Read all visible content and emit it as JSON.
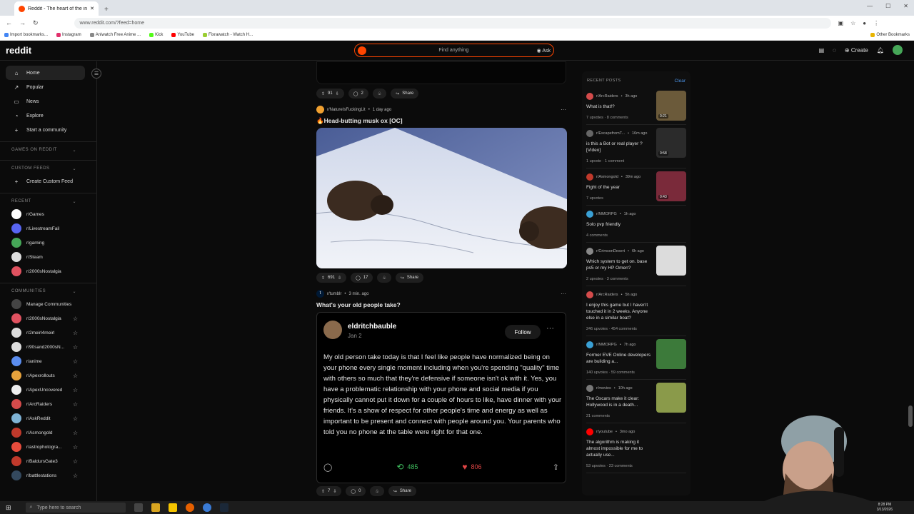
{
  "browser": {
    "tab_title": "Reddit - The heart of the intern",
    "url": "www.reddit.com/?feed=home",
    "bookmarks": [
      "Import bookmarks...",
      "Instagram",
      "Aniwatch Free Anime ...",
      "Kick",
      "YouTube",
      "Fixrawatch - Watch H..."
    ],
    "other_bookmarks": "Other Bookmarks"
  },
  "header": {
    "logo": "reddit",
    "search_placeholder": "Find anything",
    "ask_label": "Ask",
    "create_label": "Create"
  },
  "sidebar": {
    "nav": [
      {
        "label": "Home",
        "icon": "home-icon",
        "active": true
      },
      {
        "label": "Popular",
        "icon": "popular-icon"
      },
      {
        "label": "News",
        "icon": "news-icon"
      },
      {
        "label": "Explore",
        "icon": "explore-icon"
      },
      {
        "label": "Start a community",
        "icon": "plus-icon"
      }
    ],
    "games_heading": "GAMES ON REDDIT",
    "custom_feeds_heading": "CUSTOM FEEDS",
    "create_custom_feed": "Create Custom Feed",
    "recent_heading": "RECENT",
    "recent": [
      {
        "name": "r/Games",
        "color": "#ffffff"
      },
      {
        "name": "r/LivestreamFail",
        "color": "#5865f2"
      },
      {
        "name": "r/gaming",
        "color": "#46a758"
      },
      {
        "name": "r/Steam",
        "color": "#dddddd"
      },
      {
        "name": "r/2000sNostalgia",
        "color": "#e05260"
      }
    ],
    "communities_heading": "COMMUNITIES",
    "manage_communities": "Manage Communities",
    "communities": [
      {
        "name": "r/2000sNostalgia",
        "color": "#e05260"
      },
      {
        "name": "r/2meirl4meirl",
        "color": "#dddddd"
      },
      {
        "name": "r/90sand2000sN...",
        "color": "#dddddd"
      },
      {
        "name": "r/anime",
        "color": "#5b8def"
      },
      {
        "name": "r/Apexrollouts",
        "color": "#e8a33d"
      },
      {
        "name": "r/ApexUncovered",
        "color": "#eeeeee"
      },
      {
        "name": "r/ArcRaiders",
        "color": "#d44b4b"
      },
      {
        "name": "r/AskReddit",
        "color": "#7fb3d5"
      },
      {
        "name": "r/Asmongold",
        "color": "#c0392b"
      },
      {
        "name": "r/astrophotogra...",
        "color": "#e74c3c"
      },
      {
        "name": "r/BaldursGate3",
        "color": "#c0392b"
      },
      {
        "name": "r/battlestations",
        "color": "#34495e"
      }
    ]
  },
  "feed": {
    "post0_actions": {
      "votes": "91",
      "comments": "2",
      "share": "Share"
    },
    "post1": {
      "subreddit": "r/NatureIsFuckingLit",
      "time": "1 day ago",
      "title": "🔥Head-butting musk ox [OC]",
      "votes": "691",
      "comments": "17",
      "share": "Share"
    },
    "post2": {
      "subreddit": "r/tumblr",
      "time": "3 min. ago",
      "title": "What's your old people take?",
      "tweet_user": "eldritchbauble",
      "tweet_date": "Jan 2",
      "follow_label": "Follow",
      "tweet_text": "My old person take today is that I feel like people have normalized being on your phone every single moment including when you're spending \"quality\" time with others so much that they're defensive if someone isn't ok with it. Yes, you have a problematic relationship with your phone and social media if you physically cannot put it down for a couple of hours to like, have dinner with your friends. It's a show of respect for other people's time and energy as well as important to be present and connect with people around you. Your parents who told you no phone at the table were right for that one.",
      "reblogs": "485",
      "likes": "806",
      "votes": "7",
      "comments": "0",
      "share": "Share"
    }
  },
  "recent_posts": {
    "heading": "RECENT POSTS",
    "clear": "Clear",
    "items": [
      {
        "sub": "r/ArcRaiders",
        "time": "3h ago",
        "title": "What is that!?",
        "stats": "7 upvotes · 8 comments",
        "thumb": "#6b5a3a",
        "dur": "0:21",
        "sicolor": "#d44b4b"
      },
      {
        "sub": "r/EscapefromT...",
        "time": "16m ago",
        "title": "is this a Bot or real player ? [Video]",
        "stats": "1 upvote · 1 comment",
        "thumb": "#2b2b2b",
        "dur": "0:58",
        "sicolor": "#666666"
      },
      {
        "sub": "r/Asmongold",
        "time": "39m ago",
        "title": "Fight of the year",
        "stats": "7 upvotes",
        "thumb": "#7a2a3a",
        "dur": "0:43",
        "sicolor": "#c0392b"
      },
      {
        "sub": "r/MMORPG",
        "time": "1h ago",
        "title": "Solo pvp friendly",
        "stats": "4 comments",
        "thumb": "",
        "dur": "",
        "sicolor": "#3aa0d5"
      },
      {
        "sub": "r/CrimsonDesert",
        "time": "6h ago",
        "title": "Which system to get on. base ps5 or my HP Omen?",
        "stats": "2 upvotes · 3 comments",
        "thumb": "#dcdcdc",
        "dur": "",
        "sicolor": "#888888"
      },
      {
        "sub": "r/ArcRaiders",
        "time": "5h ago",
        "title": "I enjoy this game but I haven't touched it in 2 weeks. Anyone else in a similar boat?",
        "stats": "246 upvotes · 454 comments",
        "thumb": "",
        "dur": "",
        "sicolor": "#d44b4b"
      },
      {
        "sub": "r/MMORPG",
        "time": "7h ago",
        "title": "Former EVE Online developers are building a...",
        "stats": "140 upvotes · 59 comments",
        "thumb": "#3c7a3a",
        "dur": "",
        "sicolor": "#3aa0d5"
      },
      {
        "sub": "r/movies",
        "time": "10h ago",
        "title": "The Oscars make it clear: Hollywood is in a death...",
        "stats": "21 comments",
        "thumb": "#8a9a4a",
        "dur": "",
        "sicolor": "#777777"
      },
      {
        "sub": "r/youtube",
        "time": "3mo ago",
        "title": "The algorithm is making it almost impossible for me to actually use...",
        "stats": "53 upvotes · 23 comments",
        "thumb": "",
        "dur": "",
        "sicolor": "#ff0000"
      }
    ]
  },
  "taskbar": {
    "search_placeholder": "Type here to search",
    "time": "8:28 PM",
    "date": "3/13/2026"
  }
}
